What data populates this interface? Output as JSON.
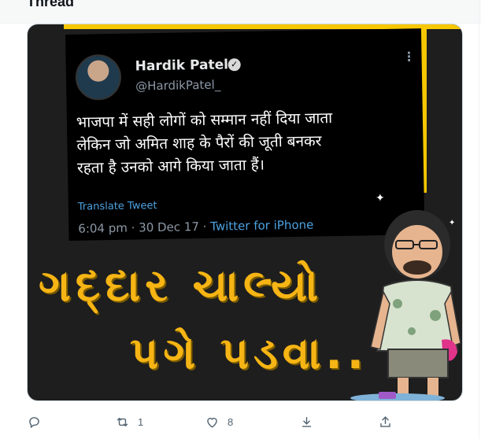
{
  "header": {
    "title": "Thread"
  },
  "embedded_tweet": {
    "author_name": "Hardik Patel",
    "handle": "@HardikPatel_",
    "text_lines": [
      "भाजपा में सही लोगों को सम्मान नहीं दिया जाता",
      "लेकिन जो अमित शाह के पैरों की जूती बनकर",
      "रहता है उनको आगे किया जाता हैं।"
    ],
    "translate_label": "Translate Tweet",
    "time": "6:04 pm · 30 Dec 17 · ",
    "source": "Twitter for iPhone"
  },
  "headline": {
    "line1": "ગદ્દાર ચાલ્યો",
    "line2": "પગે પડવા.."
  },
  "actions": {
    "reply": {
      "icon": "reply-icon",
      "count": ""
    },
    "retweet": {
      "icon": "retweet-icon",
      "count": "1"
    },
    "like": {
      "icon": "heart-icon",
      "count": "8"
    },
    "download": {
      "icon": "download-icon",
      "count": ""
    },
    "share": {
      "icon": "share-icon",
      "count": ""
    }
  },
  "colors": {
    "accent_yellow": "#f7c700",
    "headline_orange": "#f6b514",
    "link_blue": "#4ca1e0",
    "muted": "#536471"
  }
}
